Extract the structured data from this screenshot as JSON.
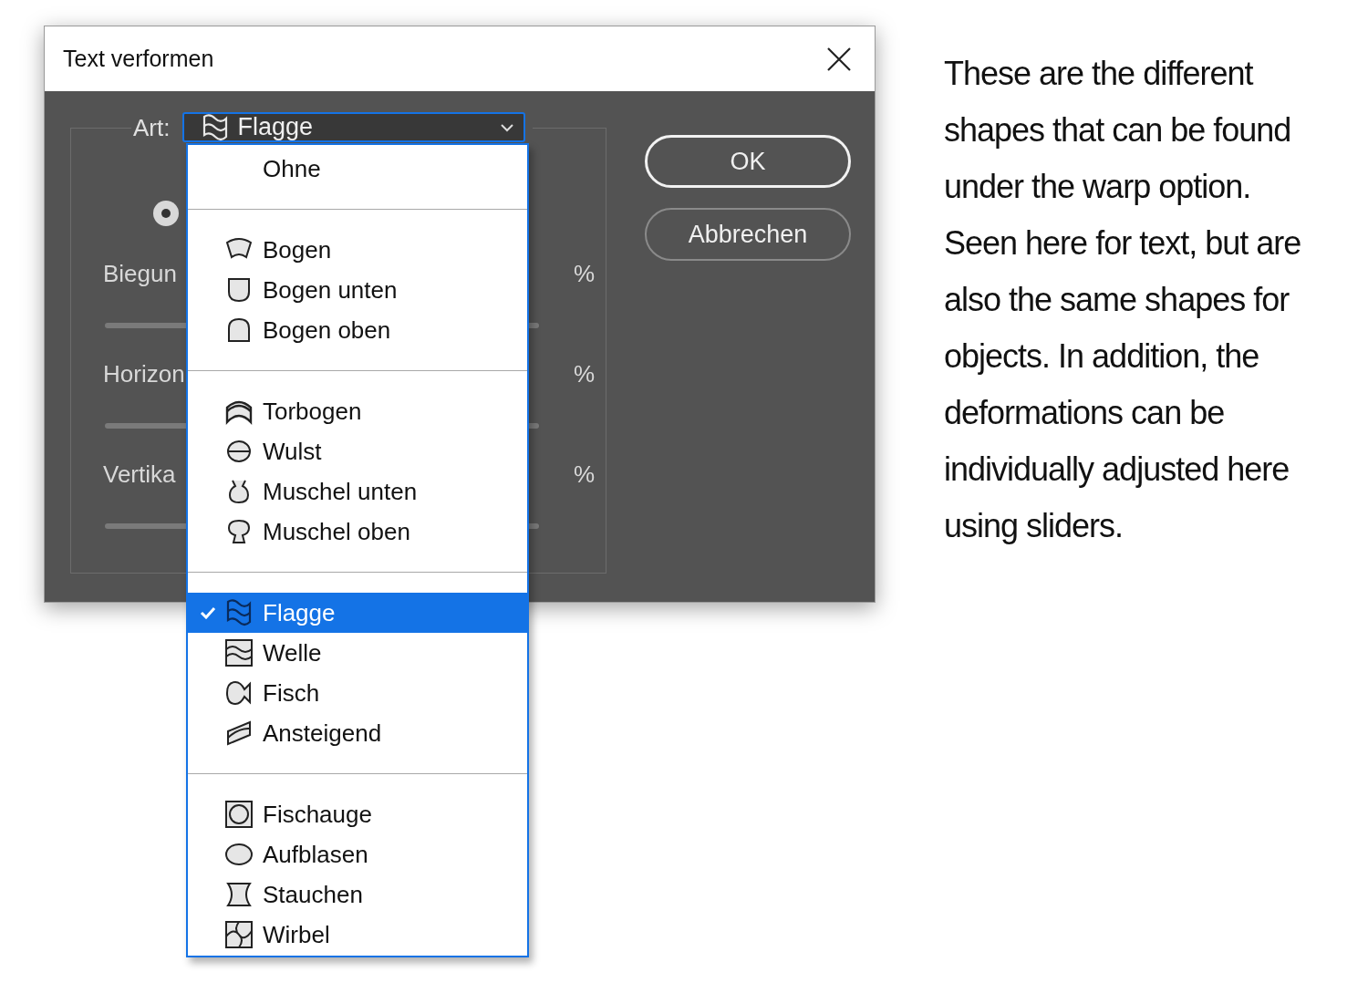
{
  "dialog": {
    "title": "Text verformen",
    "style_label": "Art:",
    "style_value": "Flagge",
    "radio": {
      "selected": true
    },
    "fields": [
      {
        "label": "Biegun",
        "unit": "%"
      },
      {
        "label": "Horizon",
        "unit": "%"
      },
      {
        "label": "Vertika",
        "unit": "%"
      }
    ],
    "buttons": [
      {
        "label": "OK",
        "default": true
      },
      {
        "label": "Abbrechen",
        "default": false
      }
    ]
  },
  "menu": {
    "groups": [
      [
        {
          "label": "Ohne",
          "kind": "none",
          "selected": false
        }
      ],
      [
        {
          "label": "Bogen",
          "kind": "arc",
          "selected": false
        },
        {
          "label": "Bogen unten",
          "kind": "arc-lower",
          "selected": false
        },
        {
          "label": "Bogen oben",
          "kind": "arc-upper",
          "selected": false
        }
      ],
      [
        {
          "label": "Torbogen",
          "kind": "arch",
          "selected": false
        },
        {
          "label": "Wulst",
          "kind": "bulge",
          "selected": false
        },
        {
          "label": "Muschel unten",
          "kind": "shell-lower",
          "selected": false
        },
        {
          "label": "Muschel oben",
          "kind": "shell-upper",
          "selected": false
        }
      ],
      [
        {
          "label": "Flagge",
          "kind": "flag",
          "selected": true
        },
        {
          "label": "Welle",
          "kind": "wave",
          "selected": false
        },
        {
          "label": "Fisch",
          "kind": "fish",
          "selected": false
        },
        {
          "label": "Ansteigend",
          "kind": "rise",
          "selected": false
        }
      ],
      [
        {
          "label": "Fischauge",
          "kind": "fisheye",
          "selected": false
        },
        {
          "label": "Aufblasen",
          "kind": "inflate",
          "selected": false
        },
        {
          "label": "Stauchen",
          "kind": "squeeze",
          "selected": false
        },
        {
          "label": "Wirbel",
          "kind": "twist",
          "selected": false
        }
      ]
    ]
  },
  "caption": "These are the different shapes that can be found under the warp option. Seen here for text, but are also the same shapes for objects. In addition, the deformations can be individually adjusted here using sliders."
}
